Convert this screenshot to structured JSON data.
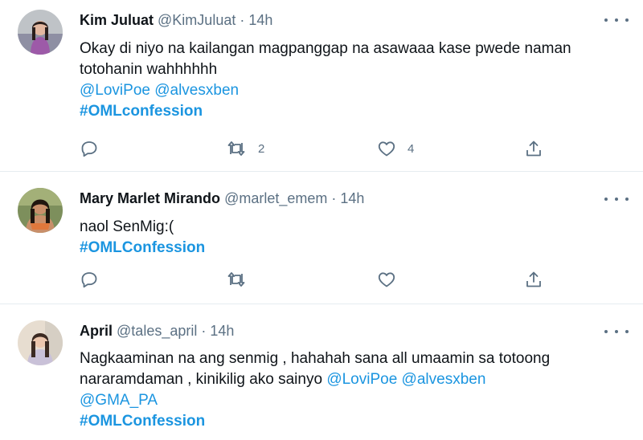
{
  "tweets": [
    {
      "name": "Kim Juluat",
      "handle": "@KimJuluat",
      "separator": "·",
      "time": "14h",
      "lines": [
        "Okay di niyo na kailangan magpanggap na asawaaa kase pwede naman",
        "totohanin wahhhhhh"
      ],
      "mentions": [
        "@LoviPoe",
        "@alvesxben"
      ],
      "hashtag": "#OMLconfession",
      "reply_count": "",
      "retweet_count": "2",
      "like_count": "4"
    },
    {
      "name": "Mary Marlet Mirando",
      "handle": "@marlet_emem",
      "separator": "·",
      "time": "14h",
      "lines": [
        "naol SenMig:("
      ],
      "hashtag": "#OMLConfession",
      "reply_count": "",
      "retweet_count": "",
      "like_count": ""
    },
    {
      "name": "April",
      "handle": "@tales_april",
      "separator": "·",
      "time": "14h",
      "line1": "Nagkaaminan na ang senmig , hahahah sana all umaamin sa totoong",
      "line2_text": "nararamdaman , kinikilig ako sainyo ",
      "mentions": [
        "@LoviPoe",
        "@alvesxben",
        "@GMA_PA"
      ],
      "hashtag": "#OMLConfession"
    }
  ],
  "icons": {
    "reply": "reply-icon",
    "retweet": "retweet-icon",
    "like": "heart-icon",
    "share": "share-icon",
    "more": "more-icon"
  },
  "colors": {
    "link": "#1b95e0",
    "secondary_text": "#5b7083",
    "divider": "#e6ecf0"
  }
}
